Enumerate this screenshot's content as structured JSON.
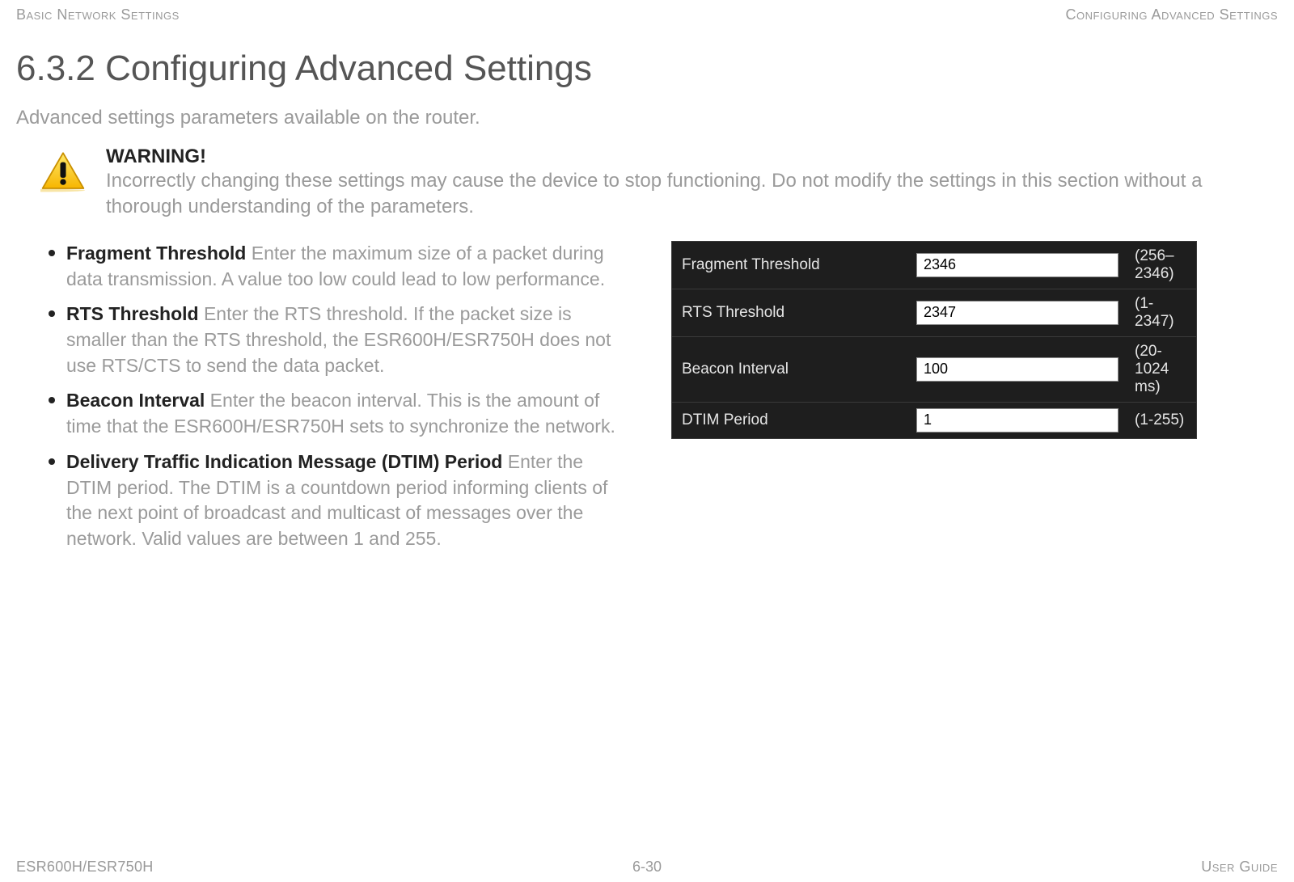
{
  "header": {
    "left": "Basic Network Settings",
    "right": "Configuring Advanced Settings"
  },
  "section": {
    "number_title": "6.3.2 Configuring Advanced Settings",
    "intro": "Advanced settings parameters available on the router."
  },
  "warning": {
    "title": "WARNING!",
    "body": "Incorrectly changing these settings may cause the device to stop functioning. Do not modify the settings in this section without a thorough understanding of the parameters."
  },
  "bullets": [
    {
      "term": "Fragment Threshold",
      "desc": "  Enter the maximum size of a packet during data transmission. A value too low could lead to low performance."
    },
    {
      "term": "RTS Threshold",
      "desc": "  Enter the RTS threshold.  If the packet size is smaller than the RTS threshold, the ESR600H/ESR750H does not use RTS/CTS to send the data packet."
    },
    {
      "term": "Beacon Interval",
      "desc": "  Enter the beacon interval. This is the amount of time that the ESR600H/ESR750H sets to synchronize the network."
    },
    {
      "term": "Delivery Traffic Indication Message (DTIM) Period",
      "desc": "  Enter the DTIM period. The DTIM is a countdown period informing clients of the next point of broadcast and multicast of messages over the network. Valid values are between 1 and 255."
    }
  ],
  "form": {
    "rows": [
      {
        "label": "Fragment Threshold",
        "value": "2346",
        "range": "(256–2346)"
      },
      {
        "label": "RTS Threshold",
        "value": "2347",
        "range": "(1-2347)"
      },
      {
        "label": "Beacon Interval",
        "value": "100",
        "range": "(20-1024 ms)"
      },
      {
        "label": "DTIM Period",
        "value": "1",
        "range": "(1-255)"
      }
    ]
  },
  "footer": {
    "left": "ESR600H/ESR750H",
    "center": "6-30",
    "right": "User Guide"
  }
}
